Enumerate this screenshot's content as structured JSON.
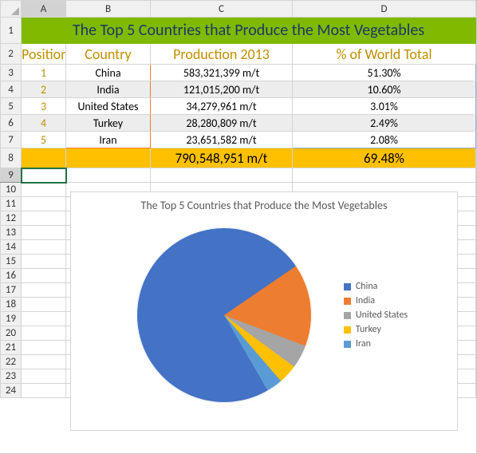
{
  "cols": [
    "A",
    "B",
    "C",
    "D"
  ],
  "title": "The Top 5 Countries that Produce the Most Vegetables",
  "headers": {
    "a": "Position",
    "b": "Country",
    "c": "Production 2013",
    "d": "% of World Total"
  },
  "rows": [
    {
      "pos": "1",
      "country": "China",
      "prod": "583,321,399 m/t",
      "pct": "51.30%"
    },
    {
      "pos": "2",
      "country": "India",
      "prod": "121,015,200 m/t",
      "pct": "10.60%"
    },
    {
      "pos": "3",
      "country": "United States",
      "prod": "34,279,961 m/t",
      "pct": "3.01%"
    },
    {
      "pos": "4",
      "country": "Turkey",
      "prod": "28,280,809 m/t",
      "pct": "2.49%"
    },
    {
      "pos": "5",
      "country": "Iran",
      "prod": "23,651,582 m/t",
      "pct": "2.08%"
    }
  ],
  "totals": {
    "prod": "790,548,951 m/t",
    "pct": "69.48%"
  },
  "row_nums": [
    "1",
    "2",
    "3",
    "4",
    "5",
    "6",
    "7",
    "8",
    "9",
    "10",
    "11",
    "12",
    "13",
    "14",
    "15",
    "16",
    "17",
    "18",
    "19",
    "20",
    "21",
    "22",
    "23",
    "24"
  ],
  "chart_data": {
    "type": "pie",
    "title": "The Top 5 Countries that Produce the Most Vegetables",
    "categories": [
      "China",
      "India",
      "United States",
      "Turkey",
      "Iran"
    ],
    "values": [
      583321399,
      121015200,
      34279961,
      28280809,
      23651582
    ],
    "colors": [
      "#4472c4",
      "#ed7d31",
      "#a5a5a5",
      "#ffc000",
      "#5b9bd5"
    ]
  }
}
